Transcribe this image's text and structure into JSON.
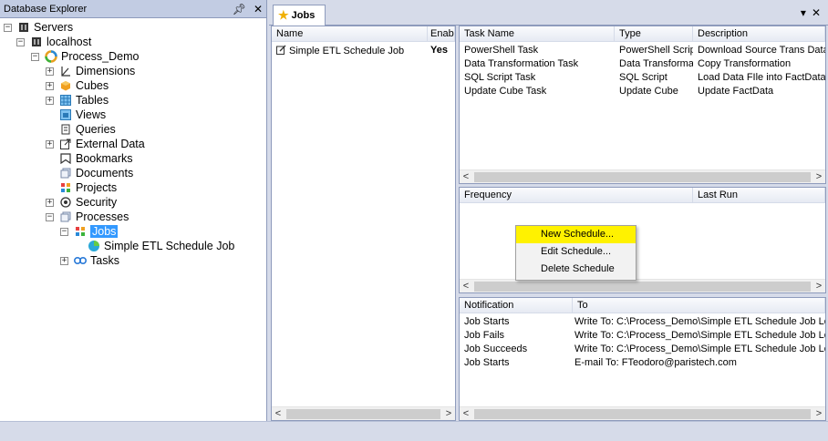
{
  "left_panel": {
    "title": "Database Explorer",
    "pin_icon": "pin-icon",
    "close_icon": "close-icon",
    "tree": [
      {
        "label": "Servers",
        "icon": "server-icon"
      },
      {
        "label": "localhost",
        "icon": "server-icon"
      },
      {
        "label": "Process_Demo",
        "icon": "database-icon"
      },
      {
        "label": "Dimensions",
        "icon": "dimensions-icon"
      },
      {
        "label": "Cubes",
        "icon": "cube-icon"
      },
      {
        "label": "Tables",
        "icon": "table-icon"
      },
      {
        "label": "Views",
        "icon": "view-icon"
      },
      {
        "label": "Queries",
        "icon": "query-icon"
      },
      {
        "label": "External Data",
        "icon": "external-data-icon"
      },
      {
        "label": "Bookmarks",
        "icon": "bookmark-icon"
      },
      {
        "label": "Documents",
        "icon": "document-icon"
      },
      {
        "label": "Projects",
        "icon": "project-icon"
      },
      {
        "label": "Security",
        "icon": "security-icon"
      },
      {
        "label": "Processes",
        "icon": "process-icon"
      },
      {
        "label": "Jobs",
        "icon": "jobs-icon"
      },
      {
        "label": "Simple ETL Schedule  Job",
        "icon": "job-icon"
      },
      {
        "label": "Tasks",
        "icon": "tasks-icon"
      }
    ]
  },
  "tab": {
    "label": "Jobs",
    "icon": "star-icon"
  },
  "jobs_list": {
    "columns": [
      "Name",
      "Enabl"
    ],
    "rows": [
      {
        "name": "Simple ETL Schedule  Job",
        "enabled": "Yes"
      }
    ]
  },
  "tasks_table": {
    "columns": [
      "Task Name",
      "Type",
      "Description"
    ],
    "rows": [
      {
        "name": "PowerShell Task",
        "type": "PowerShell Script",
        "description": "Download Source Trans Data"
      },
      {
        "name": "Data Transformation Task",
        "type": "Data Transformati...",
        "description": "Copy Transformation"
      },
      {
        "name": "SQL Script Task",
        "type": "SQL Script",
        "description": "Load Data FIle into FactData"
      },
      {
        "name": "Update Cube Task",
        "type": "Update Cube",
        "description": "Update FactData"
      }
    ]
  },
  "schedule_table": {
    "columns": [
      "Frequency",
      "Last Run"
    ]
  },
  "context_menu": {
    "items": [
      "New Schedule...",
      "Edit Schedule...",
      "Delete Schedule"
    ]
  },
  "notifications_table": {
    "columns": [
      "Notification",
      "To"
    ],
    "rows": [
      {
        "notification": "Job Starts",
        "to": "Write To: C:\\Process_Demo\\Simple ETL Schedule  Job Log.txt"
      },
      {
        "notification": "Job Fails",
        "to": "Write To: C:\\Process_Demo\\Simple ETL Schedule  Job Log.txt"
      },
      {
        "notification": "Job Succeeds",
        "to": "Write To: C:\\Process_Demo\\Simple ETL Schedule  Job Log.txt"
      },
      {
        "notification": "Job Starts",
        "to": "E-mail To: FTeodoro@paristech.com"
      }
    ]
  },
  "colors": {
    "selection": "#3399ff",
    "highlight": "#fff200",
    "chrome": "#d6dbe9"
  }
}
